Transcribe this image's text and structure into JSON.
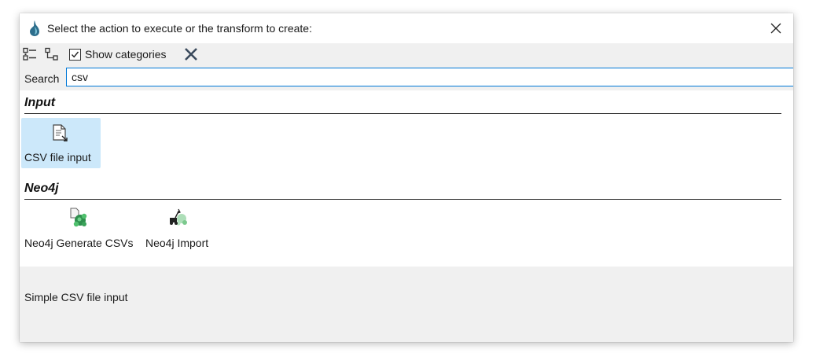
{
  "window": {
    "title": "Select the action to execute or the transform to create:"
  },
  "toolbar": {
    "expand_icon": "list-icon",
    "tree_icon": "tree-icon",
    "show_categories_label": "Show categories",
    "show_categories_checked": true,
    "clear_icon": "close-x-icon"
  },
  "search": {
    "label": "Search",
    "value": "csv"
  },
  "categories": [
    {
      "name": "Input",
      "items": [
        {
          "label": "CSV file input",
          "icon": "csv-file-input-icon",
          "selected": true
        }
      ]
    },
    {
      "name": "Neo4j",
      "items": [
        {
          "label": "Neo4j Generate CSVs",
          "icon": "neo4j-generate-csv-icon",
          "selected": false
        },
        {
          "label": "Neo4j Import",
          "icon": "neo4j-import-icon",
          "selected": false
        }
      ]
    }
  ],
  "description": "Simple CSV file input",
  "colors": {
    "selection": "#cce8fa",
    "focus_border": "#0078d7",
    "neo4j_green": "#3fa85a"
  }
}
